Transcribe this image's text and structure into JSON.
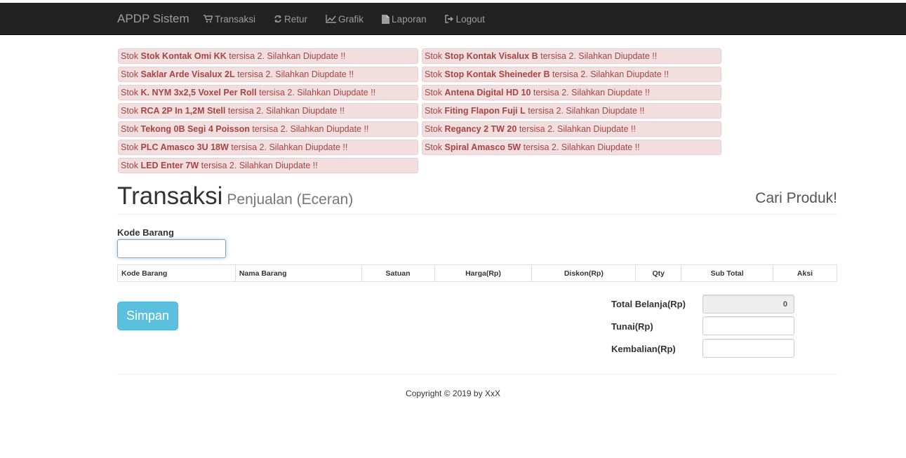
{
  "navbar": {
    "brand": "APDP Sistem",
    "items": [
      {
        "label": "Transaksi",
        "icon": "cart-icon"
      },
      {
        "label": "Retur",
        "icon": "refresh-icon"
      },
      {
        "label": "Grafik",
        "icon": "line-chart-icon"
      },
      {
        "label": "Laporan",
        "icon": "file-icon"
      },
      {
        "label": "Logout",
        "icon": "logout-icon"
      }
    ]
  },
  "alerts": {
    "prefix": "Stok",
    "suffix": "tersisa 2. Silahkan Diupdate !!",
    "items": [
      "Stok Kontak Omi KK",
      "Stop Kontak Visalux B",
      "Saklar Arde Visalux 2L",
      "Stop Kontak Sheineder B",
      "K. NYM 3x2,5 Voxel Per Roll",
      "Antena Digital HD 10",
      "RCA 2P In 1,2M Stell",
      "Fiting Flapon Fuji L",
      "Tekong 0B Segi 4 Poisson",
      "Regancy 2 TW 20",
      "PLC Amasco 3U 18W",
      "Spiral Amasco 5W",
      "LED Enter 7W"
    ]
  },
  "header": {
    "title": "Transaksi",
    "subtitle": "Penjualan (Eceran)",
    "search_link": "Cari Produk!"
  },
  "form": {
    "kode_label": "Kode Barang",
    "kode_value": ""
  },
  "table": {
    "columns": [
      "Kode Barang",
      "Nama Barang",
      "Satuan",
      "Harga(Rp)",
      "Diskon(Rp)",
      "Qty",
      "Sub Total",
      "Aksi"
    ]
  },
  "actions": {
    "save_label": "Simpan"
  },
  "totals": {
    "total_label": "Total Belanja(Rp)",
    "total_value": "0",
    "tunai_label": "Tunai(Rp)",
    "tunai_value": "",
    "kembalian_label": "Kembalian(Rp)",
    "kembalian_value": ""
  },
  "footer": {
    "copyright": "Copyright © 2019 by XxX"
  },
  "colors": {
    "navbar_bg": "#222222",
    "alert_bg": "#f2dede",
    "alert_text": "#a94442",
    "save_button": "#5bc0de"
  }
}
